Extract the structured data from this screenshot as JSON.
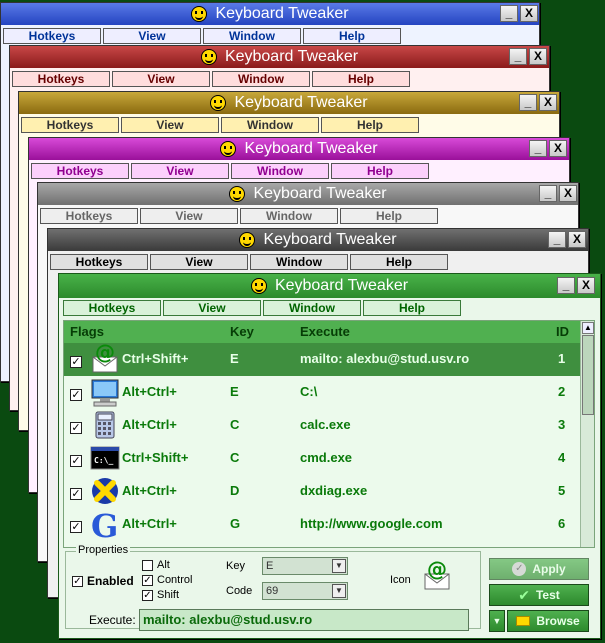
{
  "app_title": "Keyboard Tweaker",
  "menu": [
    "Hotkeys",
    "View",
    "Window",
    "Help"
  ],
  "window_controls": {
    "minimize": "_",
    "close": "X"
  },
  "list": {
    "headers": {
      "flags": "Flags",
      "key": "Key",
      "execute": "Execute",
      "id": "ID"
    },
    "rows": [
      {
        "checked": "✓",
        "modifiers": "Ctrl+Shift+",
        "key": "E",
        "execute": "mailto: alexbu@stud.usv.ro",
        "id": "1",
        "icon": "email-icon"
      },
      {
        "checked": "✓",
        "modifiers": "Alt+Ctrl+",
        "key": "E",
        "execute": "C:\\",
        "id": "2",
        "icon": "computer-icon"
      },
      {
        "checked": "✓",
        "modifiers": "Alt+Ctrl+",
        "key": "C",
        "execute": "calc.exe",
        "id": "3",
        "icon": "calculator-icon"
      },
      {
        "checked": "✓",
        "modifiers": "Ctrl+Shift+",
        "key": "C",
        "execute": "cmd.exe",
        "id": "4",
        "icon": "console-icon"
      },
      {
        "checked": "✓",
        "modifiers": "Alt+Ctrl+",
        "key": "D",
        "execute": "dxdiag.exe",
        "id": "5",
        "icon": "directx-icon"
      },
      {
        "checked": "✓",
        "modifiers": "Alt+Ctrl+",
        "key": "G",
        "execute": "http://www.google.com",
        "id": "6",
        "icon": "google-icon"
      }
    ]
  },
  "properties": {
    "legend": "Properties",
    "enabled_label": "Enabled",
    "enabled_check": "✓",
    "alt_label": "Alt",
    "control_label": "Control",
    "control_check": "✓",
    "shift_label": "Shift",
    "shift_check": "✓",
    "key_label": "Key",
    "key_value": "E",
    "code_label": "Code",
    "code_value": "69",
    "icon_label": "Icon",
    "execute_label": "Execute:",
    "execute_value": "mailto: alexbu@stud.usv.ro"
  },
  "buttons": {
    "apply": "Apply",
    "test": "Test",
    "browse": "Browse",
    "down_arrow": "▼"
  },
  "colors": {
    "accent_green": "#2c8a2c",
    "selection": "#3f8f3f",
    "back_windows": [
      "#3a5ad0",
      "#b02828",
      "#a8881a",
      "#b81ab8",
      "#8a8a8a",
      "#555555"
    ]
  }
}
